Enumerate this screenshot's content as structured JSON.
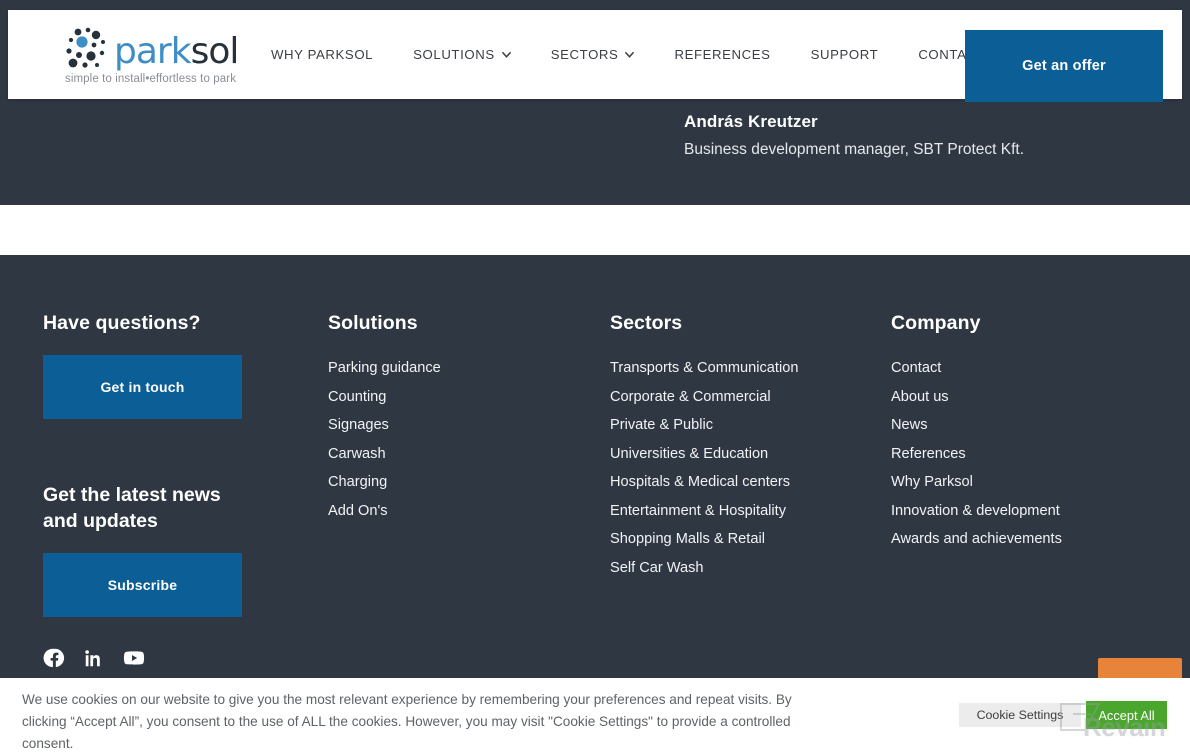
{
  "header": {
    "logo": {
      "part1": "park",
      "part2": "sol",
      "tagline": "simple to install•effortless to park",
      "icon": "parksol-dots-logo",
      "color_part1": "#3e8ec4",
      "color_part2": "#26313c"
    },
    "nav": [
      {
        "label": "WHY PARKSOL",
        "has_dropdown": false
      },
      {
        "label": "SOLUTIONS",
        "has_dropdown": true
      },
      {
        "label": "SECTORS",
        "has_dropdown": true
      },
      {
        "label": "REFERENCES",
        "has_dropdown": false
      },
      {
        "label": "SUPPORT",
        "has_dropdown": false
      },
      {
        "label": "CONTACT",
        "has_dropdown": false
      }
    ],
    "cta_label": "Get an offer",
    "cta_color": "#0b5e96"
  },
  "testimonial": {
    "name": "András Kreutzer",
    "role": "Business development manager, SBT Protect Kft."
  },
  "footer": {
    "questions": {
      "heading": "Have questions?",
      "button_label": "Get in touch"
    },
    "newsletter": {
      "heading": "Get the latest news and updates",
      "button_label": "Subscribe"
    },
    "solutions": {
      "heading": "Solutions",
      "items": [
        "Parking guidance",
        "Counting",
        "Signages",
        "Carwash",
        "Charging",
        "Add On's"
      ]
    },
    "sectors": {
      "heading": "Sectors",
      "items": [
        "Transports & Communication",
        "Corporate & Commercial",
        "Private & Public",
        "Universities & Education",
        "Hospitals & Medical centers",
        "Entertainment & Hospitality",
        "Shopping Malls & Retail",
        "Self Car Wash"
      ]
    },
    "company": {
      "heading": "Company",
      "items": [
        "Contact",
        "About us",
        "News",
        "References",
        "Why Parksol",
        "Innovation & development",
        "Awards and achievements"
      ]
    },
    "socials": [
      {
        "name": "facebook-icon"
      },
      {
        "name": "linkedin-icon"
      },
      {
        "name": "youtube-icon"
      }
    ],
    "background_color": "#2e3742"
  },
  "cookie_banner": {
    "text": "We use cookies on our website to give you the most relevant experience by remembering your preferences and repeat visits. By clicking “Accept All”, you consent to the use of ALL the cookies. However, you may visit \"Cookie Settings\" to provide a controlled consent.",
    "settings_label": "Cookie Settings",
    "accept_label": "Accept All",
    "accept_color": "#4aa62d"
  },
  "watermark": {
    "label": "Revain"
  }
}
